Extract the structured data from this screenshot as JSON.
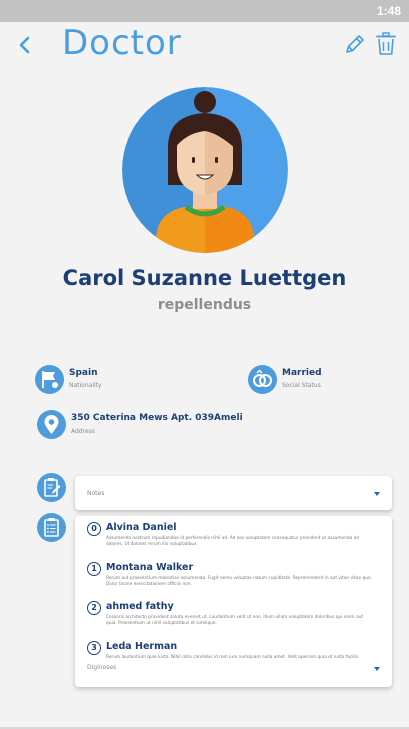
{
  "status_bar": {
    "time": "1:48"
  },
  "header": {
    "title": "Doctor"
  },
  "profile": {
    "name": "Carol Suzanne Luettgen",
    "subtitle": "repellendus"
  },
  "info": {
    "nationality": {
      "value": "Spain",
      "label": "Nationality"
    },
    "social_status": {
      "value": "Married",
      "label": "Social Status"
    },
    "address": {
      "value": "350 Caterina Mews Apt. 039Ameli",
      "label": "Address"
    }
  },
  "notes": {
    "label": "Notes"
  },
  "diagnoses": {
    "label": "Diginoses",
    "items": [
      {
        "index": "0",
        "name": "Alvina Daniel",
        "description": "Assumenda nostrum repudiandae id perferendis nihil ad. Ad eos voluptatem consequatur provident ut assumenda ad dolores. Ut dolores rerum illo voluptatibus."
      },
      {
        "index": "1",
        "name": "Montana Walker",
        "description": "Rerum aut praesentium molestias assumenda. Fugit nemo voluptas natum cupiditate. Reprehenderit in aut vitae vitae quo. Dolor facere exercitationem officiis non."
      },
      {
        "index": "2",
        "name": "ahmed fathy",
        "description": "Corporis architecto provident soluta eveniet ut. Laudantium velit ut non. Illum ullam voluptatem doloribus qui enim aut quia. Praesentium ut nihil voluptatibus et similique."
      },
      {
        "index": "3",
        "name": "Leda Herman",
        "description": "Rerum laudantium quia iusto. Nihil ratio candidus id rem iure numquam nulla amet. Velit aperiam quia et iusto facilis."
      }
    ]
  },
  "colors": {
    "accent": "#4a9ee0",
    "name_text": "#1d3f77",
    "status_bar": "#c2c2c2",
    "background": "#f3f3f3"
  },
  "icons": {
    "back": "chevron-left-icon",
    "edit": "pencil-icon",
    "delete": "trash-icon",
    "nationality": "flag-icon",
    "social_status": "rings-icon",
    "address": "location-pin-icon",
    "notes": "clipboard-pen-icon",
    "diagnoses": "clipboard-list-icon"
  }
}
